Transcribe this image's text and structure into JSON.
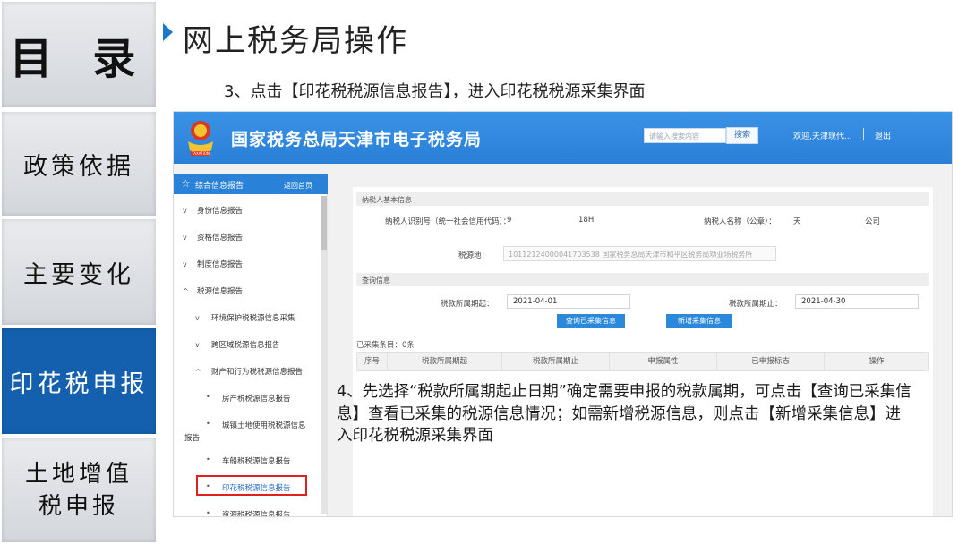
{
  "catalog": {
    "title": "目 录",
    "items": [
      {
        "label": "政策依据"
      },
      {
        "label": "主要变化"
      },
      {
        "label": "印花税申报"
      },
      {
        "label": "土地增值税申报"
      }
    ]
  },
  "slide": {
    "heading": "网上税务局操作",
    "step3": "3、点击【印花税税源信息报告】，进入印花税税源采集界面",
    "step4": "4、先选择“税款所属期起止日期”确定需要申报的税款属期，可点击【查询已采集信息】查看已采集的税源信息情况；如需新增税源信息，则点击【新增采集信息】进入印花税税源采集界面"
  },
  "portal": {
    "site_title": "国家税务总局天津市电子税务局",
    "emblem_caption": "TAXATION",
    "search_placeholder": "请输入搜索内容",
    "search_button": "搜索",
    "welcome": "欢迎,天津现代...",
    "logout": "退出",
    "sidebar": {
      "header": "综合信息报告",
      "back": "返回首页",
      "items": [
        {
          "chevron": "v",
          "label": "身份信息报告"
        },
        {
          "chevron": "v",
          "label": "资格信息报告"
        },
        {
          "chevron": "v",
          "label": "制度信息报告"
        },
        {
          "chevron": "^",
          "label": "税源信息报告"
        },
        {
          "chevron": "v",
          "label": "环境保护税税源信息采集"
        },
        {
          "chevron": "v",
          "label": "跨区域税源信息报告"
        },
        {
          "chevron": "^",
          "label": "财产和行为税税源信息报告"
        },
        {
          "chevron": "•",
          "label": "房产税税源信息报告"
        },
        {
          "chevron": "•",
          "label": "城镇土地使用税税源信息"
        },
        {
          "chevron": "",
          "label": "报告"
        },
        {
          "chevron": "•",
          "label": "车船税税源信息报告"
        },
        {
          "chevron": "•",
          "label": "印花税税源信息报告"
        },
        {
          "chevron": "•",
          "label": "资源税税源信息报告"
        }
      ]
    },
    "basic_info": {
      "section": "纳税人基本信息",
      "taxpayer_id_label": "纳税人识别号（统一社会信用代码）：",
      "taxpayer_id_prefix": "9",
      "taxpayer_id_suffix": "18H",
      "taxpayer_name_label": "纳税人名称（公章）：",
      "taxpayer_name_prefix": "天",
      "taxpayer_name_suffix": "公司",
      "tax_authority_label": "税源地：",
      "tax_authority_value": "10112124000041703538 国家税务总局天津市和平区税务局劝业场税务所"
    },
    "query": {
      "section": "查询信息",
      "start_label": "税款所属期起：",
      "start_value": "2021-04-01",
      "end_label": "税款所属期止：",
      "end_value": "2021-04-30",
      "query_button": "查询已采集信息",
      "add_button": "新增采集信息"
    },
    "collected": {
      "count": "已采集条目：0条",
      "columns": [
        "序号",
        "税款所属期起",
        "税款所属期止",
        "申报属性",
        "已申报标志",
        "操作"
      ]
    }
  },
  "colors": {
    "accent": "#1460ae",
    "portal_blue": "#2a7fd6",
    "highlight": "#e01f1f"
  }
}
